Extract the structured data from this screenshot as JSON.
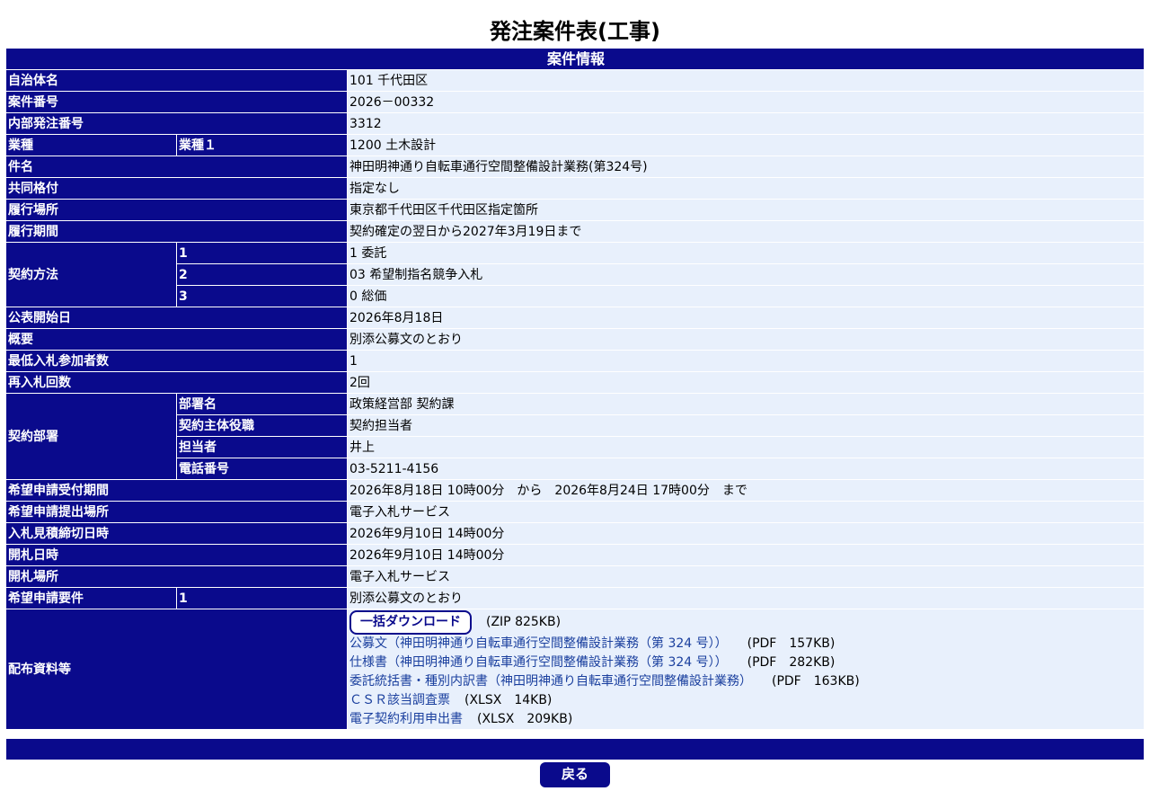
{
  "page": {
    "title": "発注案件表(工事)",
    "section_header": "案件情報",
    "back_label": "戻る"
  },
  "fields": {
    "municipality": {
      "label": "自治体名",
      "value": "101 千代田区"
    },
    "case_number": {
      "label": "案件番号",
      "value": "2026－00332"
    },
    "internal_number": {
      "label": "内部発注番号",
      "value": "3312"
    },
    "industry": {
      "label": "業種",
      "sub_label": "業種１",
      "value": "1200 土木設計"
    },
    "subject": {
      "label": "件名",
      "value": "神田明神通り自転車通行空間整備設計業務(第324号)"
    },
    "joint_rating": {
      "label": "共同格付",
      "value": "指定なし"
    },
    "location": {
      "label": "履行場所",
      "value": "東京都千代田区千代田区指定箇所"
    },
    "period": {
      "label": "履行期間",
      "value": "契約確定の翌日から2027年3月19日まで"
    },
    "contract_method": {
      "label": "契約方法",
      "rows": [
        {
          "sub_label": "1",
          "value": "1 委託"
        },
        {
          "sub_label": "2",
          "value": "03 希望制指名競争入札"
        },
        {
          "sub_label": "3",
          "value": "0 総価"
        }
      ]
    },
    "publish_start": {
      "label": "公表開始日",
      "value": "2026年8月18日"
    },
    "overview": {
      "label": "概要",
      "value": "別添公募文のとおり"
    },
    "min_bidders": {
      "label": "最低入札参加者数",
      "value": "1"
    },
    "rebid_count": {
      "label": "再入札回数",
      "value": "2回"
    },
    "dept": {
      "label": "契約部署",
      "rows": [
        {
          "sub_label": "部署名",
          "value": "政策経営部 契約課"
        },
        {
          "sub_label": "契約主体役職",
          "value": "契約担当者"
        },
        {
          "sub_label": "担当者",
          "value": "井上"
        },
        {
          "sub_label": "電話番号",
          "value": "03-5211-4156"
        }
      ]
    },
    "application_period": {
      "label": "希望申請受付期間",
      "value": "2026年8月18日 10時00分　から　2026年8月24日 17時00分　まで"
    },
    "application_place": {
      "label": "希望申請提出場所",
      "value": "電子入札サービス"
    },
    "bid_deadline": {
      "label": "入札見積締切日時",
      "value": "2026年9月10日 14時00分"
    },
    "opening_datetime": {
      "label": "開札日時",
      "value": "2026年9月10日 14時00分"
    },
    "opening_place": {
      "label": "開札場所",
      "value": "電子入札サービス"
    },
    "requirements": {
      "label": "希望申請要件",
      "sub_label": "1",
      "value": "別添公募文のとおり"
    },
    "materials": {
      "label": "配布資料等",
      "download_all_label": "一括ダウンロード",
      "download_all_size": "(ZIP 825KB)",
      "files": [
        {
          "name": "公募文（神田明神通り自転車通行空間整備設計業務（第 324 号））",
          "meta": "(PDF　157KB)"
        },
        {
          "name": "仕様書（神田明神通り自転車通行空間整備設計業務（第 324 号））",
          "meta": "(PDF　282KB)"
        },
        {
          "name": "委託統括書・種別内訳書（神田明神通り自転車通行空間整備設計業務）",
          "meta": "(PDF　163KB)"
        },
        {
          "name": "ＣＳＲ該当調査票",
          "meta": "(XLSX　14KB)"
        },
        {
          "name": "電子契約利用申出書",
          "meta": "(XLSX　209KB)"
        }
      ]
    }
  },
  "colors": {
    "header_bg": "#0a0a8c",
    "value_bg": "#e8f0fc",
    "link": "#1a3f9e"
  }
}
